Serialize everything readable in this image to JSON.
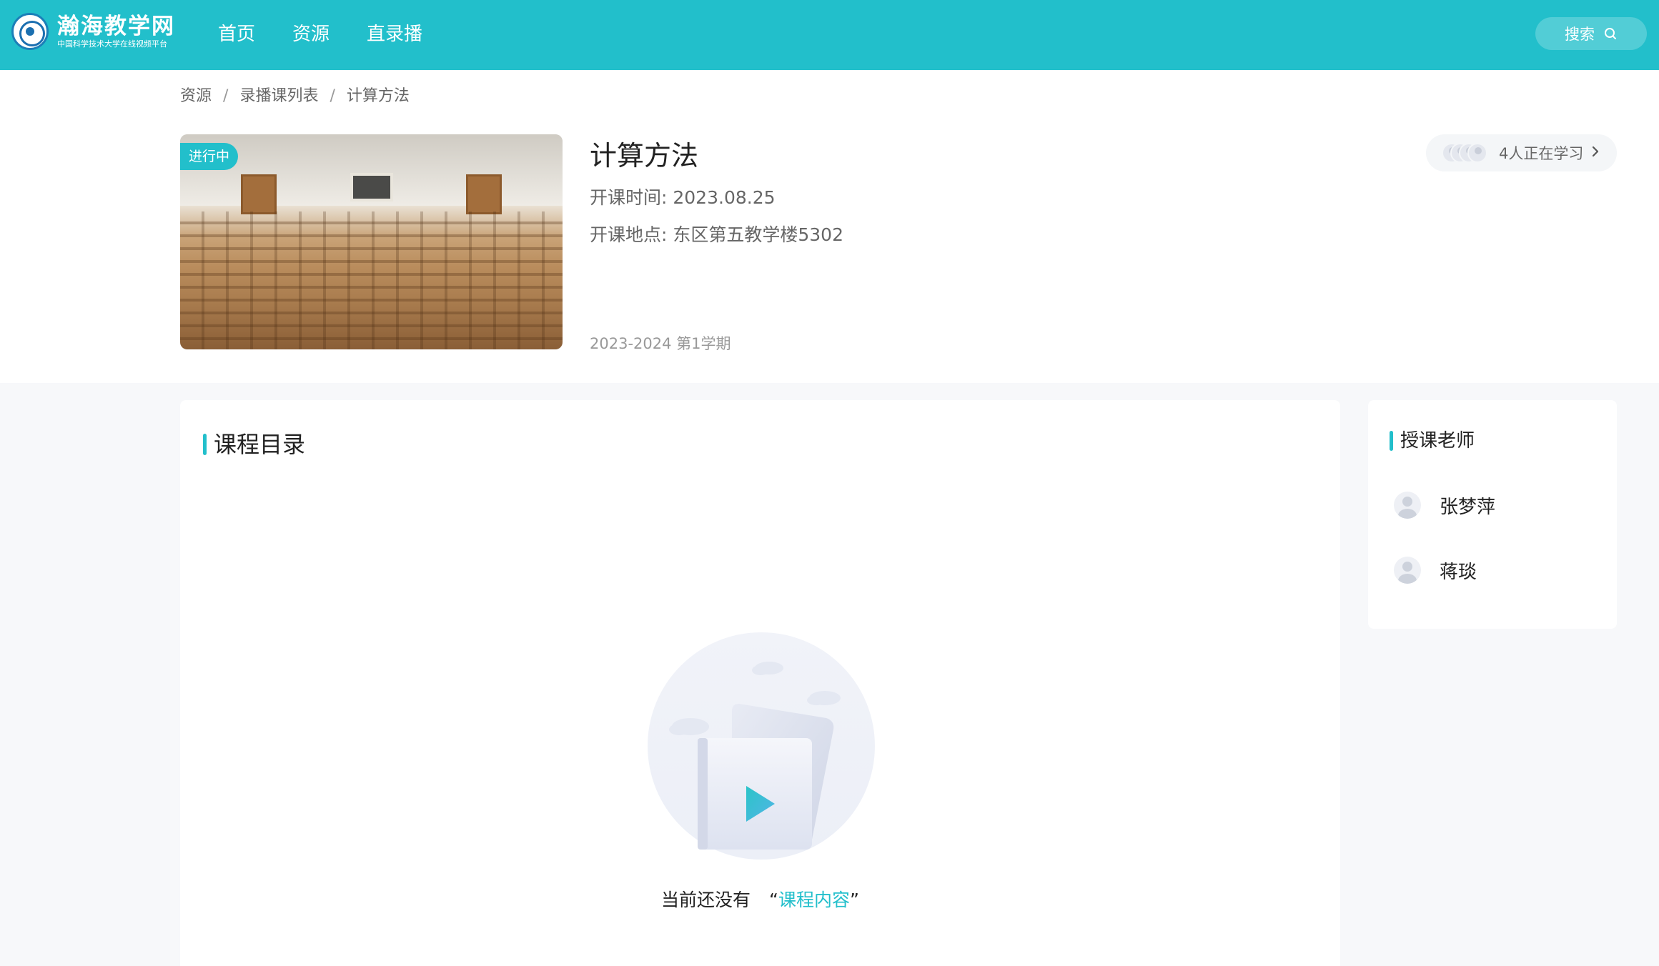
{
  "header": {
    "logo_title": "瀚海教学网",
    "logo_subtitle": "中国科学技术大学在线视频平台",
    "nav": [
      "首页",
      "资源",
      "直录播"
    ],
    "search_label": "搜索"
  },
  "breadcrumb": {
    "items": [
      "资源",
      "录播课列表",
      "计算方法"
    ],
    "separator": "/"
  },
  "course": {
    "status_badge": "进行中",
    "title": "计算方法",
    "start_time": "开课时间: 2023.08.25",
    "location": "开课地点: 东区第五教学楼5302",
    "term": "2023-2024 第1学期",
    "learners_text": "4人正在学习"
  },
  "catalog": {
    "title": "课程目录",
    "empty_prefix": "当前还没有",
    "empty_open_quote": "“",
    "empty_link": "课程内容",
    "empty_close_quote": "”"
  },
  "teachers": {
    "title": "授课老师",
    "list": [
      "张梦萍",
      "蒋琰"
    ]
  },
  "colors": {
    "accent": "#22bfcb",
    "text_primary": "#222222",
    "text_secondary": "#666666",
    "page_bg": "#f7f8fa"
  }
}
